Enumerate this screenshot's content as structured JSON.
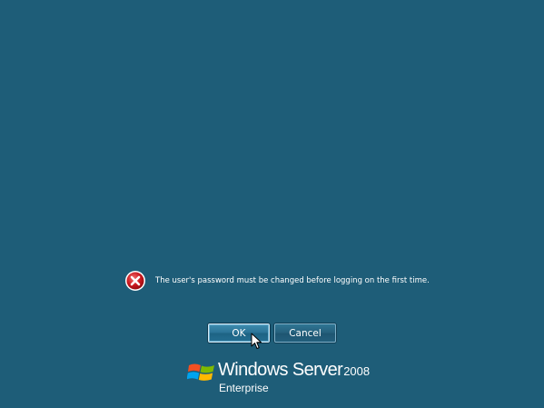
{
  "dialog": {
    "message": "The user's password must be changed before logging on the first time.",
    "icon": "error-icon",
    "ok_label": "OK",
    "cancel_label": "Cancel"
  },
  "branding": {
    "product_name": "Windows Server",
    "version": "2008",
    "edition": "Enterprise",
    "logo_icon": "windows-flag-icon"
  },
  "colors": {
    "background": "#1e5d78",
    "error_red": "#c8161d",
    "text": "#ffffff"
  }
}
